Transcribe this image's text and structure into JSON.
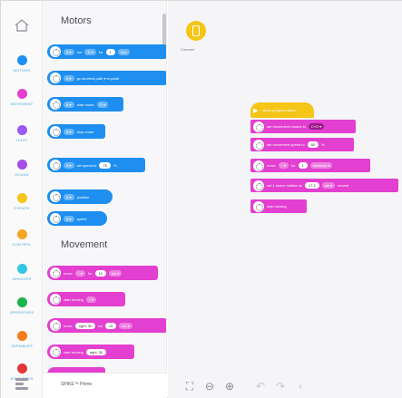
{
  "rail": {
    "categories": [
      {
        "label": "MOTORS",
        "color": "#1e8ff0"
      },
      {
        "label": "MOVEMENT",
        "color": "#e33fd0"
      },
      {
        "label": "LIGHT",
        "color": "#9b59f2"
      },
      {
        "label": "SOUND",
        "color": "#a64ee6"
      },
      {
        "label": "EVENTS",
        "color": "#f5c518"
      },
      {
        "label": "CONTROL",
        "color": "#f5a623"
      },
      {
        "label": "SENSORS",
        "color": "#32c7e6"
      },
      {
        "label": "OPERATORS",
        "color": "#1bb34a"
      },
      {
        "label": "VARIABLES",
        "color": "#f57c1c"
      },
      {
        "label": "MY BLOCKS",
        "color": "#e5353a"
      }
    ]
  },
  "palette": {
    "section_motors": "Motors",
    "section_movement": "Movement",
    "motors_blocks": [
      {
        "port": "A ▾",
        "text": "run",
        "dir": "↻ ▾",
        "mid": "for",
        "value": "1",
        "unit": "rota"
      },
      {
        "port": "A ▾",
        "text": "go  shortest path ▾  to positi"
      },
      {
        "port": "A ▾",
        "text": "start motor",
        "dir": "↻ ▾"
      },
      {
        "port": "A ▾",
        "text": "stop motor"
      },
      {
        "port": "A ▾",
        "text": "set speed to",
        "value": "75",
        "unit": "%"
      },
      {
        "port": "A ▾",
        "text": "position"
      },
      {
        "port": "A ▾",
        "text": "speed"
      }
    ],
    "movement_blocks": [
      {
        "text": "move",
        "dir": "↑ ▾",
        "mid": "for",
        "value": "10",
        "unit": "cm ▾"
      },
      {
        "text": "start moving",
        "dir": "↑ ▾"
      },
      {
        "text": "move",
        "value1": "right: 30",
        "mid": "for",
        "value": "10",
        "unit": "cm ▾"
      },
      {
        "text": "start moving",
        "value1": "right: 30"
      }
    ]
  },
  "hubbar": {
    "label": "SPIKE™ Prime"
  },
  "canvas": {
    "connect_label": "Connect",
    "program": [
      {
        "kind": "hat",
        "text": "when program starts"
      },
      {
        "kind": "pink",
        "text": "set movement motors to",
        "value": "C+D ▾"
      },
      {
        "kind": "pink",
        "text": "set movement speed to",
        "value": "50",
        "unit": "%"
      },
      {
        "kind": "pink",
        "text": "move",
        "dir": "↑ ▾",
        "mid": "for",
        "value": "1",
        "unit": "rotations ▾"
      },
      {
        "kind": "pink",
        "text": "set 1 motor rotation to",
        "value": "17.5",
        "unit": "cm ▾",
        "tail": "moved"
      },
      {
        "kind": "pink",
        "text": "stop moving"
      }
    ],
    "toolbar": {
      "fit_icon": "⛶",
      "zoom_out_icon": "⊖",
      "zoom_in_icon": "⊕",
      "undo_icon": "↶",
      "redo_icon": "↷",
      "collapse_icon": "‹"
    }
  }
}
